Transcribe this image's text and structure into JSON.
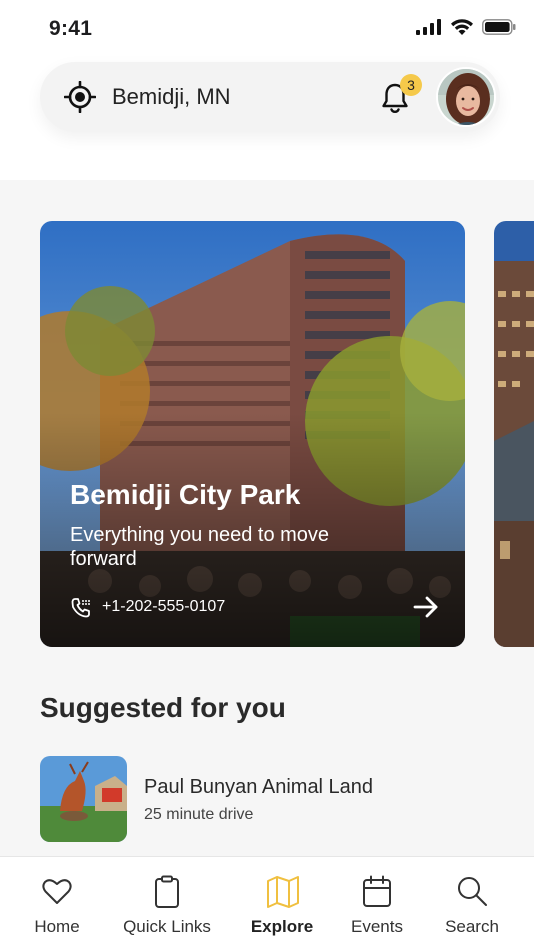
{
  "status_bar": {
    "time": "9:41"
  },
  "header": {
    "location": "Bemidji, MN",
    "notification_count": "3"
  },
  "featured_card": {
    "title": "Bemidji City Park",
    "subtitle": "Everything you need to move forward",
    "phone": "+1-202-555-0107"
  },
  "suggested": {
    "heading": "Suggested for you",
    "items": [
      {
        "name": "Paul Bunyan Animal Land",
        "detail": "25 minute drive"
      }
    ]
  },
  "tabbar": {
    "active": "Explore",
    "tabs": [
      {
        "label": "Home",
        "icon": "heart-icon"
      },
      {
        "label": "Quick Links",
        "icon": "clipboard-icon"
      },
      {
        "label": "Explore",
        "icon": "map-icon"
      },
      {
        "label": "Events",
        "icon": "calendar-icon"
      },
      {
        "label": "Search",
        "icon": "search-icon"
      }
    ]
  },
  "colors": {
    "accent": "#f5c94a",
    "background": "#f6f6f6"
  }
}
